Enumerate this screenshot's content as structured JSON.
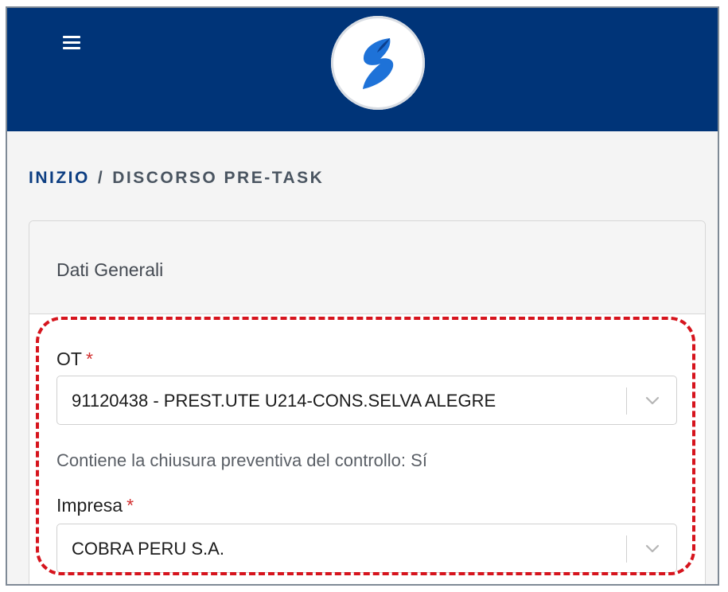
{
  "header": {
    "menu_icon": "hamburger-menu-icon",
    "logo_icon": "company-logo",
    "background_color": "#003478"
  },
  "breadcrumb": {
    "home": "INIZIO",
    "separator": "/",
    "current": "DISCORSO PRE-TASK"
  },
  "card": {
    "title": "Dati Generali",
    "ot": {
      "label": "OT",
      "required_mark": "*",
      "value": "91120438 - PREST.UTE U214-CONS.SELVA ALEGRE",
      "chevron_icon": "chevron-down-icon"
    },
    "info_text": "Contiene la chiusura preventiva del controllo: Sí",
    "impresa": {
      "label": "Impresa",
      "required_mark": "*",
      "value": "COBRA PERU S.A.",
      "chevron_icon": "chevron-down-icon"
    }
  },
  "colors": {
    "brand": "#003478",
    "required": "#d23030",
    "highlight": "#d6141d"
  }
}
